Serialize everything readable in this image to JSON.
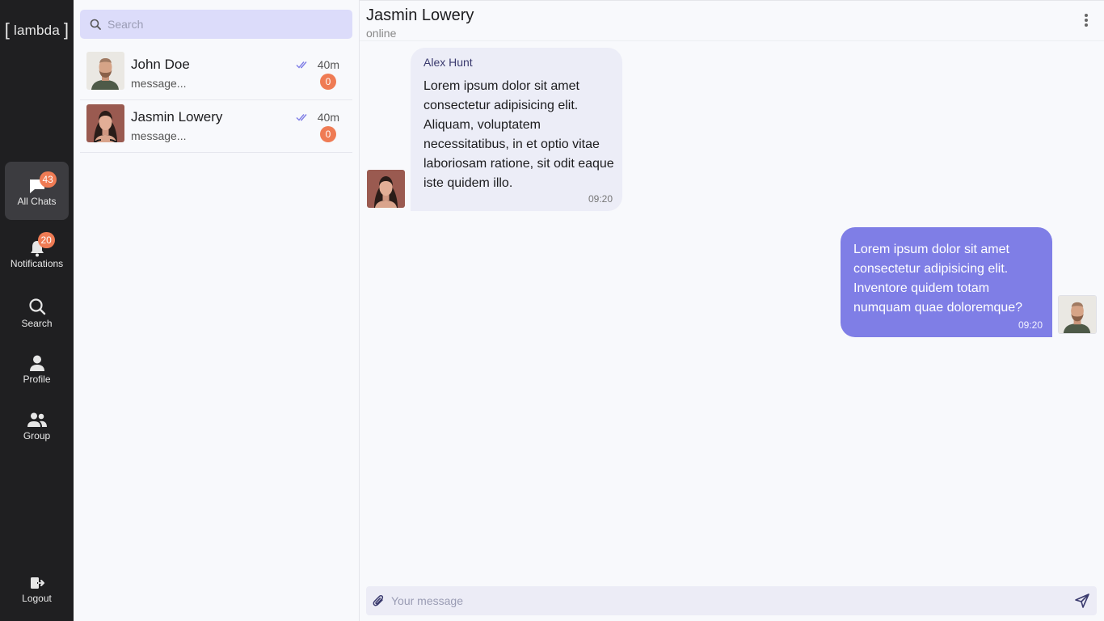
{
  "app": {
    "logo_text": "lambda",
    "logo_open": "[",
    "logo_close": "]"
  },
  "nav": {
    "all_chats": {
      "label": "All Chats",
      "badge": "43"
    },
    "notifications": {
      "label": "Notifications",
      "badge": "20"
    },
    "search": {
      "label": "Search"
    },
    "profile": {
      "label": "Profile"
    },
    "group": {
      "label": "Group"
    },
    "logout": {
      "label": "Logout"
    }
  },
  "search": {
    "placeholder": "Search"
  },
  "chats": [
    {
      "name": "John Doe",
      "preview": "message...",
      "time": "40m",
      "unread": "0"
    },
    {
      "name": "Jasmin Lowery",
      "preview": "message...",
      "time": "40m",
      "unread": "0"
    }
  ],
  "conversation": {
    "name": "Jasmin Lowery",
    "status": "online",
    "messages": [
      {
        "from": "Alex Hunt",
        "text": "Lorem ipsum dolor sit amet consectetur adipisicing elit. Aliquam, voluptatem necessitatibus, in et optio vitae laboriosam ratione, sit odit eaque iste quidem illo.",
        "time": "09:20"
      },
      {
        "text": "Lorem ipsum dolor sit amet consectetur adipisicing elit. Inventore quidem totam numquam quae doloremque?",
        "time": "09:20"
      }
    ],
    "composer_placeholder": "Your message"
  },
  "colors": {
    "accent": "#7f7ee6",
    "badge": "#ef7b54",
    "sidebar": "#1f1f21",
    "search_bg": "#dcdcfa"
  },
  "icons": [
    "chat-icon",
    "bell-icon",
    "search-icon",
    "user-icon",
    "group-icon",
    "logout-icon",
    "double-check-icon",
    "more-vertical-icon",
    "paperclip-icon",
    "send-icon"
  ]
}
